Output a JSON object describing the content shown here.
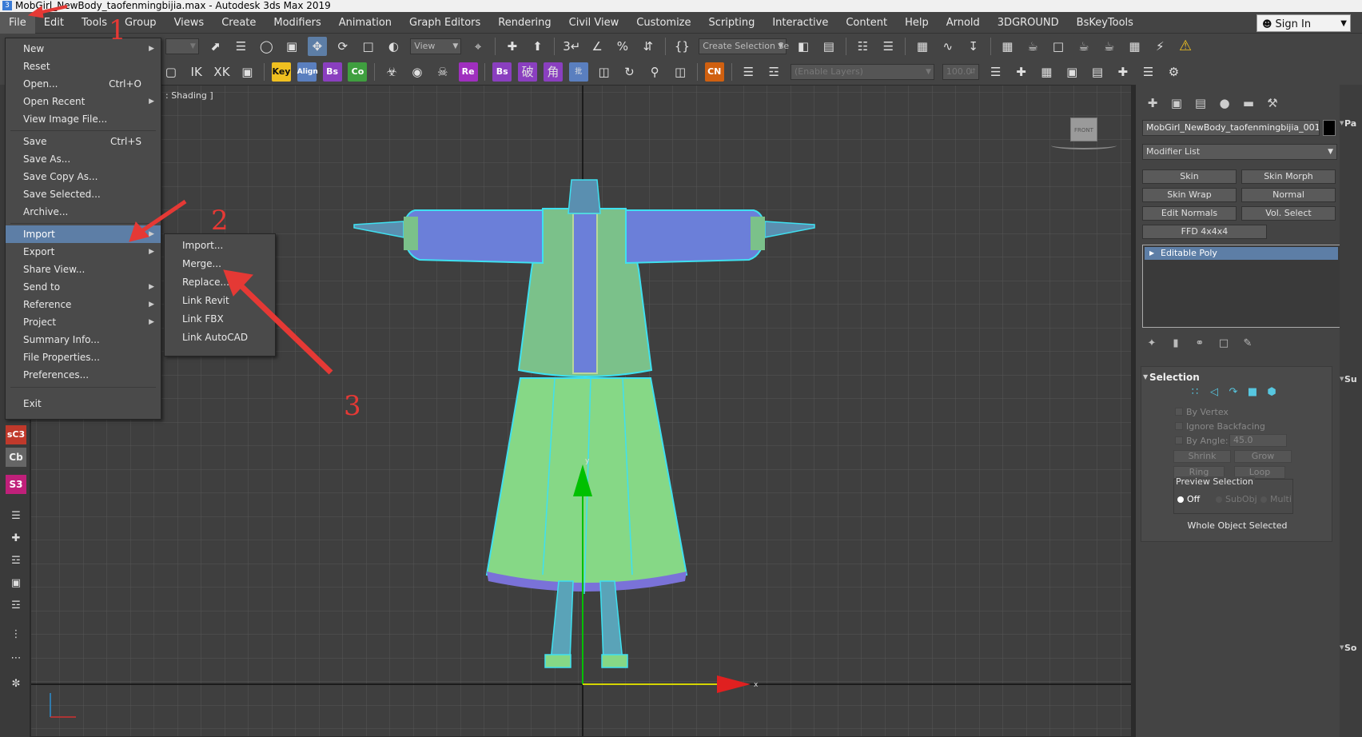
{
  "window": {
    "title": "MobGirl_NewBody_taofenmingbijia.max - Autodesk 3ds Max 2019",
    "app_icon_glyph": "3"
  },
  "menubar": {
    "items": [
      "File",
      "Edit",
      "Tools",
      "Group",
      "Views",
      "Create",
      "Modifiers",
      "Animation",
      "Graph Editors",
      "Rendering",
      "Civil View",
      "Customize",
      "Scripting",
      "Interactive",
      "Content",
      "Help",
      "Arnold",
      "3DGROUND",
      "BsKeyTools"
    ],
    "sign_in": "Sign In"
  },
  "toolbar1": {
    "view_dropdown": "View",
    "create_selection_set": "Create Selection Se"
  },
  "toolbar2": {
    "key": "Key",
    "align": "Align",
    "bs": "Bs",
    "co": "Co",
    "re": "Re",
    "bs2": "Bs",
    "cn": "CN",
    "enable_layers": "(Enable Layers)",
    "layer_value": "100.0"
  },
  "leftstrip": {
    "sc3": "sC3",
    "cb": "Cb",
    "s3": "S3"
  },
  "viewport": {
    "label": ": Shading ]",
    "viewcube_label": "FRONT",
    "axis_x": "x",
    "axis_y": "y"
  },
  "file_menu": {
    "items": [
      {
        "label": "New",
        "shortcut": "",
        "submenu": true
      },
      {
        "label": "Reset",
        "shortcut": "",
        "submenu": false
      },
      {
        "label": "Open...",
        "shortcut": "Ctrl+O",
        "submenu": false
      },
      {
        "label": "Open Recent",
        "shortcut": "",
        "submenu": true
      },
      {
        "label": "View Image File...",
        "shortcut": "",
        "submenu": false
      },
      {
        "label": "Save",
        "shortcut": "Ctrl+S",
        "submenu": false
      },
      {
        "label": "Save As...",
        "shortcut": "",
        "submenu": false
      },
      {
        "label": "Save Copy As...",
        "shortcut": "",
        "submenu": false
      },
      {
        "label": "Save Selected...",
        "shortcut": "",
        "submenu": false
      },
      {
        "label": "Archive...",
        "shortcut": "",
        "submenu": false
      },
      {
        "label": "Import",
        "shortcut": "",
        "submenu": true
      },
      {
        "label": "Export",
        "shortcut": "",
        "submenu": true
      },
      {
        "label": "Share View...",
        "shortcut": "",
        "submenu": false
      },
      {
        "label": "Send to",
        "shortcut": "",
        "submenu": true
      },
      {
        "label": "Reference",
        "shortcut": "",
        "submenu": true
      },
      {
        "label": "Project",
        "shortcut": "",
        "submenu": true
      },
      {
        "label": "Summary Info...",
        "shortcut": "",
        "submenu": false
      },
      {
        "label": "File Properties...",
        "shortcut": "",
        "submenu": false
      },
      {
        "label": "Preferences...",
        "shortcut": "",
        "submenu": false
      },
      {
        "label": "Exit",
        "shortcut": "",
        "submenu": false
      }
    ],
    "highlighted": "Import"
  },
  "import_submenu": {
    "items": [
      "Import...",
      "Merge...",
      "Replace...",
      "Link Revit",
      "Link FBX",
      "Link AutoCAD"
    ]
  },
  "command_panel": {
    "object_name": "MobGirl_NewBody_taofenmingbijia_001",
    "modifier_list": "Modifier List",
    "modifier_buttons": [
      "Skin",
      "Skin Morph",
      "Skin Wrap",
      "Normal",
      "Edit Normals",
      "Vol. Select",
      "FFD 4x4x4"
    ],
    "stack_item": "Editable Poly",
    "selection": {
      "title": "Selection",
      "by_vertex": "By Vertex",
      "ignore_backfacing": "Ignore Backfacing",
      "by_angle": "By Angle:",
      "angle_value": "45.0",
      "shrink": "Shrink",
      "grow": "Grow",
      "ring": "Ring",
      "loop": "Loop",
      "preview_selection": "Preview Selection",
      "off": "Off",
      "subobj": "SubObj",
      "multi": "Multi",
      "status": "Whole Object Selected"
    }
  },
  "right_slim": {
    "labels": [
      "Pa",
      "Su",
      "So"
    ]
  },
  "annotations": {
    "steps": [
      "1",
      "2",
      "3"
    ],
    "color": "#e53935"
  },
  "colors": {
    "highlight": "#5d7ea6",
    "model_blue": "#6b7fd9",
    "model_green": "#8fd88f",
    "selection_outline": "#3fe0f0"
  }
}
